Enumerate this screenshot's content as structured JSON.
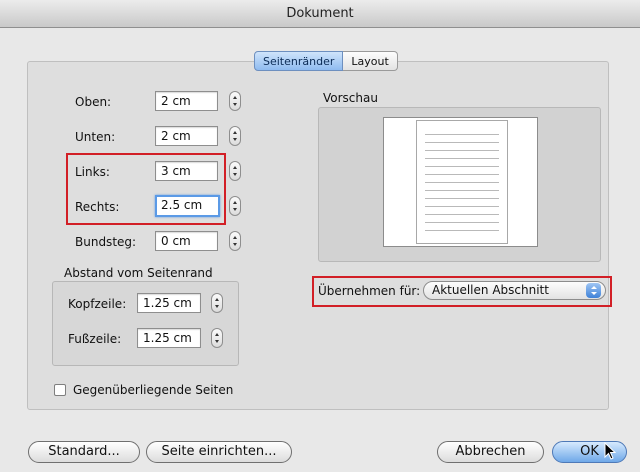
{
  "window": {
    "title": "Dokument"
  },
  "tabs": [
    {
      "label": "Seitenränder",
      "active": true
    },
    {
      "label": "Layout",
      "active": false
    }
  ],
  "margins": {
    "top": {
      "label": "Oben:",
      "value": "2 cm"
    },
    "bottom": {
      "label": "Unten:",
      "value": "2 cm"
    },
    "left": {
      "label": "Links:",
      "value": "3 cm"
    },
    "right": {
      "label": "Rechts:",
      "value": "2.5 cm"
    },
    "gutter": {
      "label": "Bundsteg:",
      "value": "0 cm"
    }
  },
  "header_footer": {
    "group_label": "Abstand vom Seitenrand",
    "header": {
      "label": "Kopfzeile:",
      "value": "1.25 cm"
    },
    "footer": {
      "label": "Fußzeile:",
      "value": "1.25 cm"
    }
  },
  "mirror": {
    "label": "Gegenüberliegende Seiten",
    "checked": false
  },
  "preview": {
    "label": "Vorschau"
  },
  "apply_to": {
    "label": "Übernehmen für:",
    "value": "Aktuellen Abschnitt"
  },
  "buttons": {
    "default": "Standard...",
    "page_setup": "Seite einrichten...",
    "cancel": "Abbrechen",
    "ok": "OK"
  },
  "colors": {
    "highlight": "#d21f26",
    "accent": "#5b9ae6"
  }
}
